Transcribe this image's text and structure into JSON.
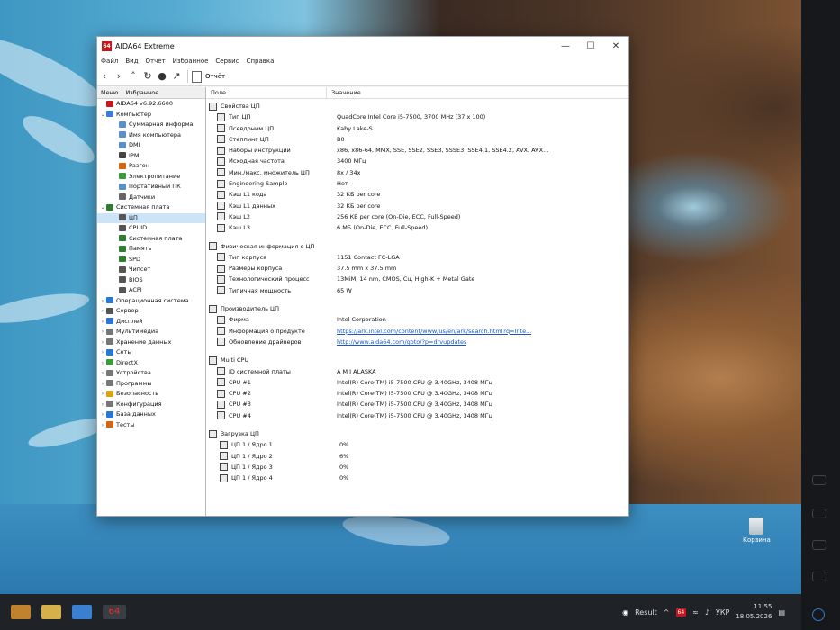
{
  "window": {
    "title": "AIDA64 Extreme",
    "app_icon_text": "64",
    "minimize": "—",
    "maximize": "☐",
    "close": "✕"
  },
  "menu": [
    "Файл",
    "Вид",
    "Отчёт",
    "Избранное",
    "Сервис",
    "Справка"
  ],
  "toolbar": {
    "report_label": "Отчёт",
    "icons": [
      "back-icon",
      "forward-icon",
      "up-icon",
      "refresh-icon",
      "user-icon",
      "chart-icon"
    ]
  },
  "left_tabs": [
    "Меню",
    "Избранное"
  ],
  "tree": [
    {
      "label": "AIDA64 v6.92.6600",
      "level": 0,
      "expander": "",
      "color": "#c8141a"
    },
    {
      "label": "Компьютер",
      "level": 0,
      "expander": "⌄",
      "color": "#3a7bd5"
    },
    {
      "label": "Суммарная информа",
      "level": 1,
      "expander": "",
      "color": "#5a8fc8"
    },
    {
      "label": "Имя компьютера",
      "level": 1,
      "expander": "",
      "color": "#5a8fc8"
    },
    {
      "label": "DMI",
      "level": 1,
      "expander": "",
      "color": "#5a8fc8"
    },
    {
      "label": "IPMI",
      "level": 1,
      "expander": "",
      "color": "#444"
    },
    {
      "label": "Разгон",
      "level": 1,
      "expander": "",
      "color": "#d9640f"
    },
    {
      "label": "Электропитание",
      "level": 1,
      "expander": "",
      "color": "#3c9a3c"
    },
    {
      "label": "Портативный ПК",
      "level": 1,
      "expander": "",
      "color": "#5a8fc8"
    },
    {
      "label": "Датчики",
      "level": 1,
      "expander": "",
      "color": "#666"
    },
    {
      "label": "Системная плата",
      "level": 0,
      "expander": "⌄",
      "color": "#2e7d32"
    },
    {
      "label": "ЦП",
      "level": 1,
      "expander": "",
      "color": "#555",
      "selected": true
    },
    {
      "label": "CPUID",
      "level": 1,
      "expander": "",
      "color": "#555"
    },
    {
      "label": "Системная плата",
      "level": 1,
      "expander": "",
      "color": "#2e7d32"
    },
    {
      "label": "Память",
      "level": 1,
      "expander": "",
      "color": "#2e7d32"
    },
    {
      "label": "SPD",
      "level": 1,
      "expander": "",
      "color": "#2e7d32"
    },
    {
      "label": "Чипсет",
      "level": 1,
      "expander": "",
      "color": "#555"
    },
    {
      "label": "BIOS",
      "level": 1,
      "expander": "",
      "color": "#555"
    },
    {
      "label": "ACPI",
      "level": 1,
      "expander": "",
      "color": "#555"
    },
    {
      "label": "Операционная система",
      "level": 0,
      "expander": "›",
      "color": "#2a78d6"
    },
    {
      "label": "Сервер",
      "level": 0,
      "expander": "›",
      "color": "#555"
    },
    {
      "label": "Дисплей",
      "level": 0,
      "expander": "›",
      "color": "#2a78d6"
    },
    {
      "label": "Мультимедиа",
      "level": 0,
      "expander": "›",
      "color": "#777"
    },
    {
      "label": "Хранение данных",
      "level": 0,
      "expander": "›",
      "color": "#777"
    },
    {
      "label": "Сеть",
      "level": 0,
      "expander": "›",
      "color": "#2a78d6"
    },
    {
      "label": "DirectX",
      "level": 0,
      "expander": "›",
      "color": "#3c9a3c"
    },
    {
      "label": "Устройства",
      "level": 0,
      "expander": "›",
      "color": "#777"
    },
    {
      "label": "Программы",
      "level": 0,
      "expander": "›",
      "color": "#777"
    },
    {
      "label": "Безопасность",
      "level": 0,
      "expander": "›",
      "color": "#d9a20f"
    },
    {
      "label": "Конфигурация",
      "level": 0,
      "expander": "›",
      "color": "#777"
    },
    {
      "label": "База данных",
      "level": 0,
      "expander": "›",
      "color": "#2a78d6"
    },
    {
      "label": "Тесты",
      "level": 0,
      "expander": "›",
      "color": "#d9640f"
    }
  ],
  "columns": {
    "field": "Поле",
    "value": "Значение"
  },
  "sections": [
    {
      "title": "Свойства ЦП",
      "rows": [
        [
          "Тип ЦП",
          "QuadCore Intel Core i5-7500, 3700 MHz (37 x 100)"
        ],
        [
          "Псевдоним ЦП",
          "Kaby Lake-S"
        ],
        [
          "Степпинг ЦП",
          "B0"
        ],
        [
          "Наборы инструкций",
          "x86, x86-64, MMX, SSE, SSE2, SSE3, SSSE3, SSE4.1, SSE4.2, AVX, AVX..."
        ],
        [
          "Исходная частота",
          "3400 МГц"
        ],
        [
          "Мин./макс. множитель ЦП",
          "8x / 34x"
        ],
        [
          "Engineering Sample",
          "Нет"
        ],
        [
          "Кэш L1 кода",
          "32 КБ per core"
        ],
        [
          "Кэш L1 данных",
          "32 КБ per core"
        ],
        [
          "Кэш L2",
          "256 КБ per core  (On-Die, ECC, Full-Speed)"
        ],
        [
          "Кэш L3",
          "6 МБ  (On-Die, ECC, Full-Speed)"
        ]
      ]
    },
    {
      "title": "Физическая информация о ЦП",
      "rows": [
        [
          "Тип корпуса",
          "1151 Contact FC-LGA"
        ],
        [
          "Размеры корпуса",
          "37.5 mm x 37.5 mm"
        ],
        [
          "Технологический процесс",
          "13МiМ, 14 nm, CMOS, Cu, High-K + Metal Gate"
        ],
        [
          "Типичная мощность",
          "65 W"
        ]
      ]
    },
    {
      "title": "Производитель ЦП",
      "rows": [
        [
          "Фирма",
          "Intel Corporation"
        ],
        [
          "Информация о продукте",
          "https://ark.intel.com/content/www/us/en/ark/search.html?q=Inte..."
        ],
        [
          "Обновление драйверов",
          "http://www.aida64.com/goto/?p=drvupdates"
        ]
      ]
    },
    {
      "title": "Multi CPU",
      "rows": [
        [
          "ID системной платы",
          "A M I ALASKA"
        ],
        [
          "CPU #1",
          "Intel(R) Core(TM) i5-7500 CPU @ 3.40GHz, 3408 МГц"
        ],
        [
          "CPU #2",
          "Intel(R) Core(TM) i5-7500 CPU @ 3.40GHz, 3408 МГц"
        ],
        [
          "CPU #3",
          "Intel(R) Core(TM) i5-7500 CPU @ 3.40GHz, 3408 МГц"
        ],
        [
          "CPU #4",
          "Intel(R) Core(TM) i5-7500 CPU @ 3.40GHz, 3408 МГц"
        ]
      ]
    },
    {
      "title": "Загрузка ЦП",
      "rows": [
        [
          "ЦП 1 / Ядро 1",
          "0%"
        ],
        [
          "ЦП 1 / Ядро 2",
          "6%"
        ],
        [
          "ЦП 1 / Ядро 3",
          "0%"
        ],
        [
          "ЦП 1 / Ядро 4",
          "0%"
        ]
      ]
    }
  ],
  "desktop": {
    "recycle_bin": "Корзина"
  },
  "taskbar": {
    "app_label": "64",
    "tray_app": "Result",
    "tray_caret": "^",
    "language": "УКР",
    "time": "11:55",
    "date": "18.05.2026"
  }
}
